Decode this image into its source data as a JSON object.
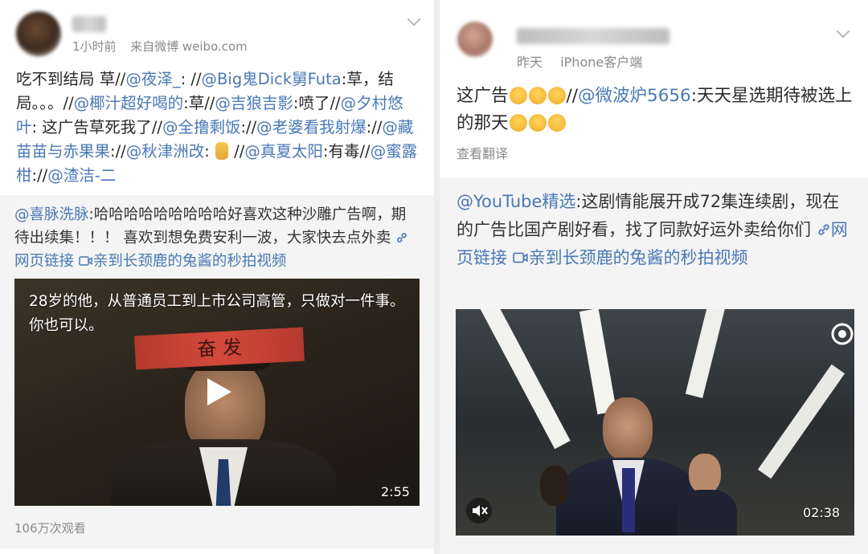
{
  "left_post": {
    "timestamp": "1小时前",
    "source": "来自微博 weibo.com",
    "text_lead": "吃不到结局 草//",
    "text_1": "@夜泽_",
    "text_2": ": //",
    "text_3": "@Big鬼Dick舅Futa",
    "text_4": ":草，结局。。。//",
    "text_5": "@椰汁超好喝的",
    "text_6": ":草//",
    "text_7": "@吉狼吉影",
    "text_8": ":喷了//",
    "text_9": "@夕村悠叶",
    "text_10": ": 这广告草死我了//",
    "text_11": "@全撸剩饭",
    "text_12": "://",
    "text_13": "@老婆看我射爆",
    "text_14": "://",
    "text_15": "@藏苗苗与赤果果",
    "text_16": "://",
    "text_17": "@秋津洲改",
    "text_18": ": ",
    "text_19": " //",
    "text_20": "@真夏太阳",
    "text_21": ":有毒//",
    "text_22": "@蜜露柑",
    "text_23": "://",
    "text_24": "@渣洁-二",
    "repost": {
      "mention": "@喜脉洗脉",
      "body": ":哈哈哈哈哈哈哈哈哈好喜欢这种沙雕广告啊，期待出续集！！！ 喜欢到想免费安利一波，大家快去点外卖",
      "link_web": "网页链接",
      "link_video": "亲到长颈鹿的兔酱的秒拍视频"
    },
    "video": {
      "caption": "28岁的他，从普通员工到上市公司高管，只做对一件事。 你也可以。",
      "duration": "2:55",
      "banner_text": "奋 发"
    },
    "views": "106万次观看"
  },
  "right_post": {
    "timestamp": "昨天",
    "source": "iPhone客户端",
    "text_lead": "这广告",
    "text_mid": "//",
    "mention": "@微波炉5656",
    "text_tail": ":天天星选期待被选上的那天",
    "translate": "查看翻译",
    "repost": {
      "mention": "@YouTube精选",
      "body": ":这剧情能展开成72集连续剧，现在的广告比国产剧好看，找了同款好运外卖给你们 ",
      "link_web": "网页链接",
      "link_video": "亲到长颈鹿的兔酱的秒拍视频"
    },
    "video": {
      "duration": "02:38"
    }
  },
  "icons": [
    "chevron-down-icon",
    "link-icon",
    "video-icon",
    "play-icon",
    "mute-icon",
    "camera-icon",
    "emoji-yum-icon",
    "emoji-cry-icon",
    "emoji-figure-icon"
  ],
  "colors": {
    "link": "#4a78b5",
    "meta": "#8a8a8a",
    "repost_bg": "#f4f4f4"
  }
}
